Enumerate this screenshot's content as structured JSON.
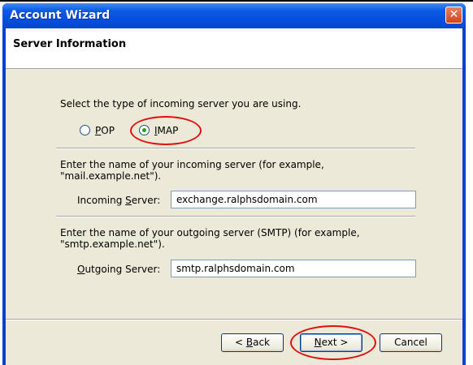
{
  "window": {
    "title": "Account Wizard"
  },
  "header": {
    "title": "Server Information"
  },
  "incoming_type": {
    "prompt": "Select the type of incoming server you are using.",
    "options": [
      {
        "label": "POP",
        "selected": false
      },
      {
        "label": "IMAP",
        "selected": true
      }
    ]
  },
  "incoming": {
    "instructions_line1": "Enter the name of your incoming server (for example,",
    "instructions_line2": "\"mail.example.net\").",
    "label": "Incoming Server:",
    "value": "exchange.ralphsdomain.com"
  },
  "outgoing": {
    "instructions_line1": "Enter the name of your outgoing server (SMTP) (for example,",
    "instructions_line2": "\"smtp.example.net\").",
    "label": "Outgoing Server:",
    "value": "smtp.ralphsdomain.com"
  },
  "buttons": {
    "back": "< Back",
    "next": "Next >",
    "cancel": "Cancel"
  },
  "colors": {
    "titlebar": "#0551e0",
    "annotation": "#e01010",
    "radio_selected": "#21a121"
  }
}
